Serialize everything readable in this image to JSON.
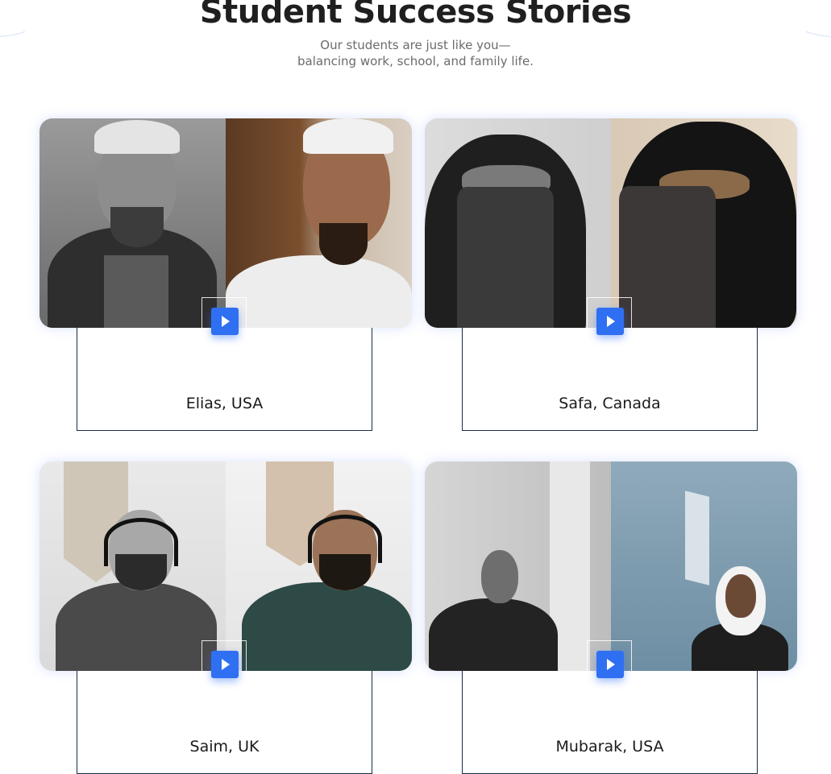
{
  "section": {
    "title": "Student Success Stories",
    "subtitle_line1": "Our students are just like you—",
    "subtitle_line2": "balancing work, school, and family life."
  },
  "stories": [
    {
      "name": "Elias, USA"
    },
    {
      "name": "Safa, Canada"
    },
    {
      "name": "Saim, UK"
    },
    {
      "name": "Mubarak, USA"
    }
  ],
  "icons": {
    "play": "play-icon"
  },
  "colors": {
    "accent": "#2f6ff2",
    "heading": "#1f1f1f",
    "subtitle": "#6b6b6b",
    "border": "#1a2a4a"
  }
}
